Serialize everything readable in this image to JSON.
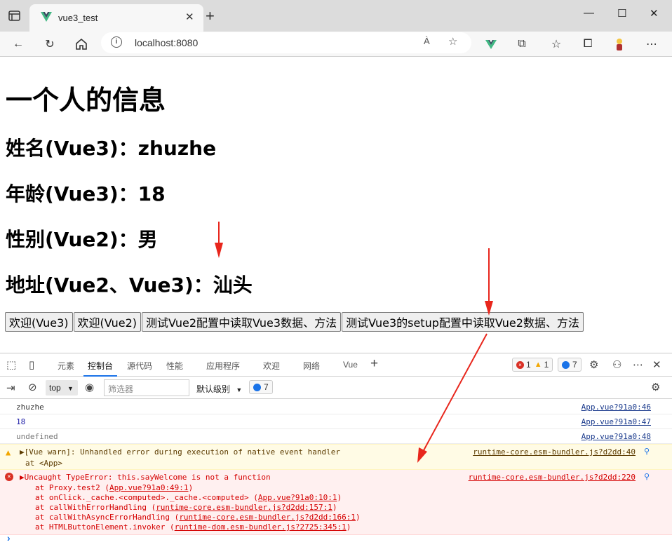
{
  "browser": {
    "tab_title": "vue3_test",
    "url": "localhost:8080",
    "read_aloud": "À"
  },
  "page": {
    "title": "一个人的信息",
    "fields": [
      "姓名(Vue3)：zhuzhe",
      "年龄(Vue3)：18",
      "性别(Vue2)：男",
      "地址(Vue2、Vue3)：汕头"
    ],
    "buttons": [
      "欢迎(Vue3)",
      "欢迎(Vue2)",
      "测试Vue2配置中读取Vue3数据、方法",
      "测试Vue3的setup配置中读取Vue2数据、方法"
    ]
  },
  "devtools": {
    "tabs": [
      "元素",
      "控制台",
      "源代码",
      "性能",
      "应用程序",
      "欢迎",
      "网络",
      "Vue"
    ],
    "active_tab": "控制台",
    "error_count": "1",
    "warning_count": "1",
    "info_count": "7",
    "context": "top",
    "filter_placeholder": "筛选器",
    "levels": "默认级别",
    "issues_count": "7",
    "logs": [
      {
        "text": "zhuzhe",
        "source": "App.vue?91a0:46"
      },
      {
        "text": "18",
        "source": "App.vue?91a0:47"
      },
      {
        "text": "undefined",
        "source": "App.vue?91a0:48"
      }
    ],
    "warning": {
      "line1": "▶[Vue warn]: Unhandled error during execution of native event handler",
      "line2": "at <App>",
      "source": "runtime-core.esm-bundler.js?d2dd:40"
    },
    "error": {
      "message": "▶Uncaught TypeError: this.sayWelcome is not a function",
      "source": "runtime-core.esm-bundler.js?d2dd:220",
      "stack": [
        {
          "prefix": "at Proxy.test2 (",
          "link": "App.vue?91a0:49:1",
          "suffix": ")"
        },
        {
          "prefix": "at onClick._cache.<computed>._cache.<computed> (",
          "link": "App.vue?91a0:10:1",
          "suffix": ")"
        },
        {
          "prefix": "at callWithErrorHandling (",
          "link": "runtime-core.esm-bundler.js?d2dd:157:1",
          "suffix": ")"
        },
        {
          "prefix": "at callWithAsyncErrorHandling (",
          "link": "runtime-core.esm-bundler.js?d2dd:166:1",
          "suffix": ")"
        },
        {
          "prefix": "at HTMLButtonElement.invoker (",
          "link": "runtime-dom.esm-bundler.js?2725:345:1",
          "suffix": ")"
        }
      ]
    },
    "prompt": "›"
  },
  "colors": {
    "arrow": "#e8261c",
    "accent": "#1a73e8",
    "error": "#d50000",
    "warning_bg": "#fffbe5"
  }
}
